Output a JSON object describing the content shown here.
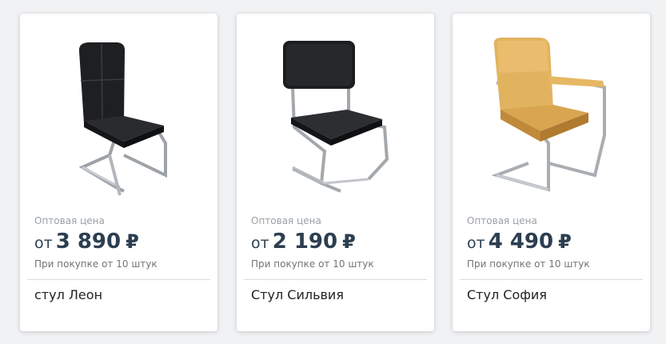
{
  "products": [
    {
      "image_icon": "chair-leon-icon",
      "price_caption": "Оптовая цена",
      "price_prefix": "от",
      "price": "3 890",
      "currency": "₽",
      "min_qty_note": "При покупке от 10 штук",
      "name": "стул Леон"
    },
    {
      "image_icon": "chair-silvia-icon",
      "price_caption": "Оптовая цена",
      "price_prefix": "от",
      "price": "2 190",
      "currency": "₽",
      "min_qty_note": "При покупке от 10 штук",
      "name": "Стул Сильвия"
    },
    {
      "image_icon": "chair-sofia-icon",
      "price_caption": "Оптовая цена",
      "price_prefix": "от",
      "price": "4 490",
      "currency": "₽",
      "min_qty_note": "При покупке от 10 штук",
      "name": "Стул София"
    }
  ],
  "colors": {
    "price_text": "#2c3e50",
    "caption_text": "#9aa0a6",
    "card_background": "#ffffff",
    "page_background": "#f1f2f4"
  }
}
